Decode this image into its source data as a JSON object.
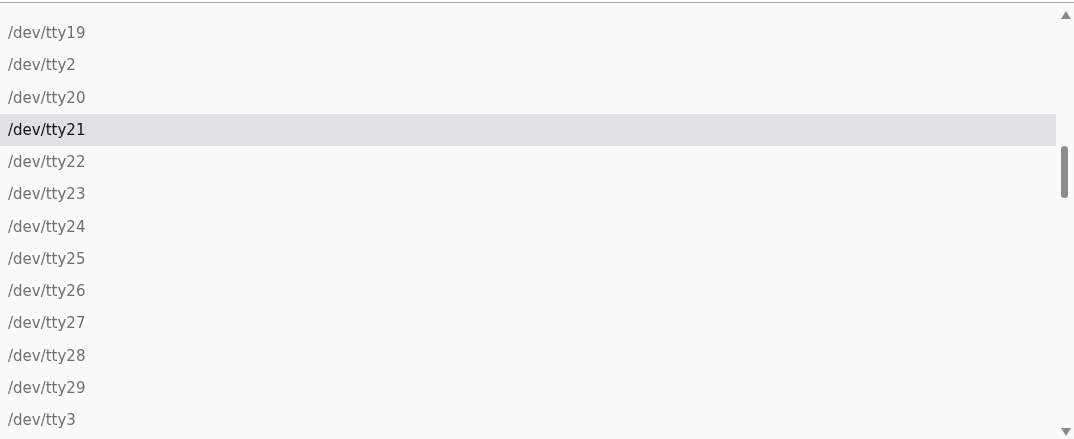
{
  "list": {
    "items": [
      {
        "label": "/dev/tty19",
        "selected": false
      },
      {
        "label": "/dev/tty2",
        "selected": false
      },
      {
        "label": "/dev/tty20",
        "selected": false
      },
      {
        "label": "/dev/tty21",
        "selected": true
      },
      {
        "label": "/dev/tty22",
        "selected": false
      },
      {
        "label": "/dev/tty23",
        "selected": false
      },
      {
        "label": "/dev/tty24",
        "selected": false
      },
      {
        "label": "/dev/tty25",
        "selected": false
      },
      {
        "label": "/dev/tty26",
        "selected": false
      },
      {
        "label": "/dev/tty27",
        "selected": false
      },
      {
        "label": "/dev/tty28",
        "selected": false
      },
      {
        "label": "/dev/tty29",
        "selected": false
      },
      {
        "label": "/dev/tty3",
        "selected": false
      }
    ]
  }
}
